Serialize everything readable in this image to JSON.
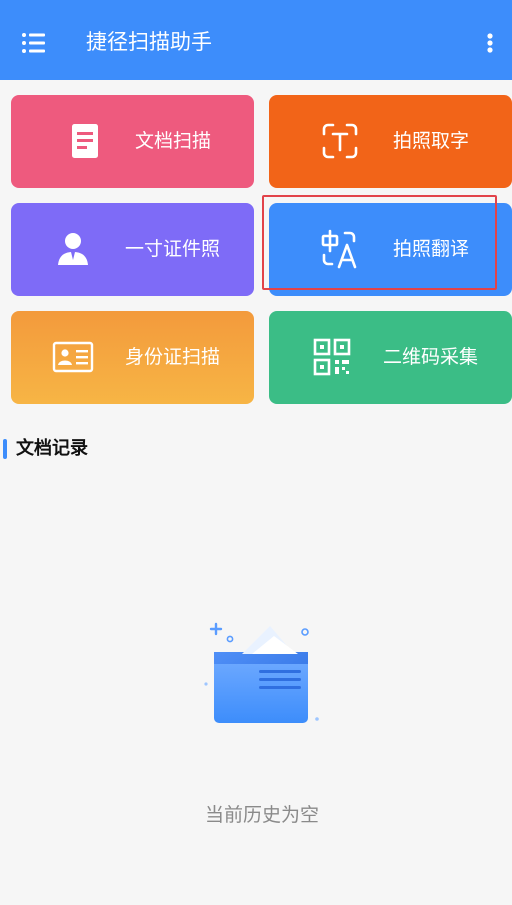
{
  "header": {
    "title": "捷径扫描助手",
    "menu_icon": "list-menu-icon",
    "more_icon": "more-vertical-icon",
    "background": "#3d8dfb"
  },
  "tiles": [
    {
      "label": "文档扫描",
      "icon": "document-icon",
      "color": "#ee5a7e"
    },
    {
      "label": "拍照取字",
      "icon": "text-scan-icon",
      "color": "#f26418"
    },
    {
      "label": "一寸证件照",
      "icon": "id-photo-person-icon",
      "color": "#7e6bf7"
    },
    {
      "label": "拍照翻译",
      "icon": "translate-icon",
      "color": "#3d8dfb",
      "highlighted": true
    },
    {
      "label": "身份证扫描",
      "icon": "id-card-icon",
      "color": "#f5a83f"
    },
    {
      "label": "二维码采集",
      "icon": "qr-code-icon",
      "color": "#3bbd86"
    }
  ],
  "highlight_color": "#e2434a",
  "records": {
    "title": "文档记录",
    "empty_icon": "empty-folder-icon",
    "empty_text": "当前历史为空"
  }
}
